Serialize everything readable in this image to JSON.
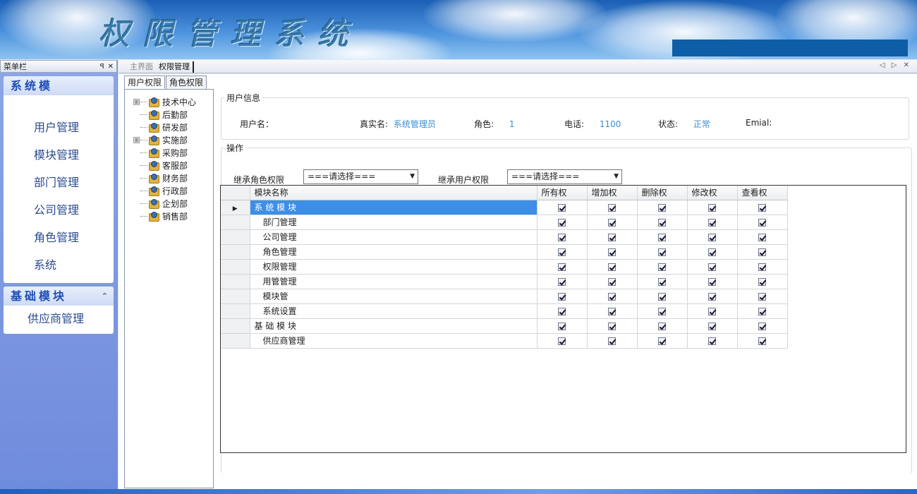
{
  "banner": {
    "title": "权限管理系统"
  },
  "menu": {
    "header_title": "菜单栏",
    "pin_label": "ꟼ",
    "close_label": "✕",
    "groups": [
      {
        "title": "系统模",
        "items": [
          "用户管理",
          "模块管理",
          "部门管理",
          "公司管理",
          "角色管理",
          "系统"
        ]
      },
      {
        "title": "基础模块",
        "chevron": "⌃",
        "items": [
          "供应商管理"
        ]
      }
    ]
  },
  "doc_tabs": {
    "tabs": [
      "主界面",
      "权限管理"
    ],
    "active": 1,
    "nav": "◁ ▷ ✕"
  },
  "sub_tabs": {
    "tabs": [
      "用户权限",
      "角色权限"
    ],
    "active": 0
  },
  "tree": {
    "nodes": [
      {
        "label": "技术中心",
        "expandable": true,
        "expander": "⊞"
      },
      {
        "label": "后勤部",
        "expandable": false
      },
      {
        "label": "研发部",
        "expandable": false
      },
      {
        "label": "实施部",
        "expandable": true,
        "expander": "⊞"
      },
      {
        "label": "采购部",
        "expandable": false
      },
      {
        "label": "客服部",
        "expandable": false
      },
      {
        "label": "财务部",
        "expandable": false
      },
      {
        "label": "行政部",
        "expandable": false
      },
      {
        "label": "企划部",
        "expandable": false
      },
      {
        "label": "销售部",
        "expandable": false
      }
    ]
  },
  "user_info": {
    "legend": "用户信息",
    "username_label": "用户名：",
    "username_value": "",
    "realname_label": "真实名:",
    "realname_value": "系统管理员",
    "role_label": "角色:",
    "role_value": "1",
    "phone_label": "电话:",
    "phone_value": "1100",
    "status_label": "状态:",
    "status_value": "正常",
    "email_label": "Emial:",
    "email_value": ""
  },
  "operations": {
    "legend": "操作",
    "inherit_role_label": "继承角色权限",
    "inherit_role_value": "===请选择===",
    "inherit_user_label": "继承用户权限",
    "inherit_user_value": "===请选择==="
  },
  "grid": {
    "columns": [
      "模块名称",
      "所有权",
      "增加权",
      "删除权",
      "修改权",
      "查看权"
    ],
    "current_row_marker": "▶",
    "rows": [
      {
        "name": "系 统 模 块",
        "level": 0,
        "selected": true,
        "checks": [
          true,
          true,
          true,
          true,
          true
        ]
      },
      {
        "name": "部门管理",
        "level": 1,
        "checks": [
          true,
          true,
          true,
          true,
          true
        ]
      },
      {
        "name": "公司管理",
        "level": 1,
        "checks": [
          true,
          true,
          true,
          true,
          true
        ]
      },
      {
        "name": "角色管理",
        "level": 1,
        "checks": [
          true,
          true,
          true,
          true,
          true
        ]
      },
      {
        "name": "权限管理",
        "level": 1,
        "checks": [
          true,
          true,
          true,
          true,
          true
        ]
      },
      {
        "name": "用管管理",
        "level": 1,
        "checks": [
          true,
          true,
          true,
          true,
          true
        ]
      },
      {
        "name": "模块管",
        "level": 1,
        "checks": [
          true,
          true,
          true,
          true,
          true
        ]
      },
      {
        "name": "系统设置",
        "level": 1,
        "checks": [
          true,
          true,
          true,
          true,
          true
        ]
      },
      {
        "name": "基 础 模 块",
        "level": 0,
        "checks": [
          true,
          true,
          true,
          true,
          true
        ]
      },
      {
        "name": "供应商管理",
        "level": 1,
        "checks": [
          true,
          true,
          true,
          true,
          true
        ]
      }
    ]
  }
}
